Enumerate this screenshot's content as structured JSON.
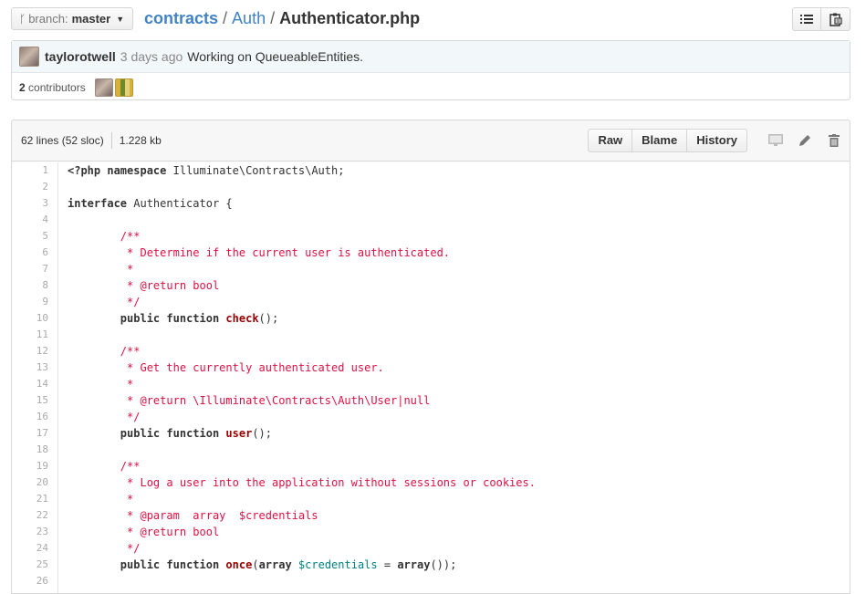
{
  "branch": {
    "label": "branch:",
    "name": "master"
  },
  "breadcrumb": {
    "root": "contracts",
    "dir": "Auth",
    "file": "Authenticator.php",
    "sep": "/"
  },
  "commit": {
    "author": "taylorotwell",
    "time": "3 days ago",
    "message": "Working on QueueableEntities.",
    "contributors_count": "2",
    "contributors_label": "contributors"
  },
  "file": {
    "lines_info": "62 lines (52 sloc)",
    "size": "1.228 kb",
    "buttons": {
      "raw": "Raw",
      "blame": "Blame",
      "history": "History"
    }
  },
  "code_lines": [
    [
      {
        "t": "<?php ",
        "c": "kw"
      },
      {
        "t": "namespace",
        "c": "kw"
      },
      {
        "t": " Illuminate\\Contracts\\Auth;",
        "c": ""
      }
    ],
    [],
    [
      {
        "t": "interface",
        "c": "kw"
      },
      {
        "t": " Authenticator {",
        "c": ""
      }
    ],
    [],
    [
      {
        "t": "        /**",
        "c": "cm"
      }
    ],
    [
      {
        "t": "         * Determine if the current user is authenticated.",
        "c": "cm"
      }
    ],
    [
      {
        "t": "         *",
        "c": "cm"
      }
    ],
    [
      {
        "t": "         * @return bool",
        "c": "cm"
      }
    ],
    [
      {
        "t": "         */",
        "c": "cm"
      }
    ],
    [
      {
        "t": "        ",
        "c": ""
      },
      {
        "t": "public",
        "c": "kw"
      },
      {
        "t": " ",
        "c": ""
      },
      {
        "t": "function",
        "c": "kw"
      },
      {
        "t": " ",
        "c": ""
      },
      {
        "t": "check",
        "c": "fn"
      },
      {
        "t": "();",
        "c": ""
      }
    ],
    [],
    [
      {
        "t": "        /**",
        "c": "cm"
      }
    ],
    [
      {
        "t": "         * Get the currently authenticated user.",
        "c": "cm"
      }
    ],
    [
      {
        "t": "         *",
        "c": "cm"
      }
    ],
    [
      {
        "t": "         * @return \\Illuminate\\Contracts\\Auth\\User|null",
        "c": "cm"
      }
    ],
    [
      {
        "t": "         */",
        "c": "cm"
      }
    ],
    [
      {
        "t": "        ",
        "c": ""
      },
      {
        "t": "public",
        "c": "kw"
      },
      {
        "t": " ",
        "c": ""
      },
      {
        "t": "function",
        "c": "kw"
      },
      {
        "t": " ",
        "c": ""
      },
      {
        "t": "user",
        "c": "fn"
      },
      {
        "t": "();",
        "c": ""
      }
    ],
    [],
    [
      {
        "t": "        /**",
        "c": "cm"
      }
    ],
    [
      {
        "t": "         * Log a user into the application without sessions or cookies.",
        "c": "cm"
      }
    ],
    [
      {
        "t": "         *",
        "c": "cm"
      }
    ],
    [
      {
        "t": "         * @param  array  $credentials",
        "c": "cm"
      }
    ],
    [
      {
        "t": "         * @return bool",
        "c": "cm"
      }
    ],
    [
      {
        "t": "         */",
        "c": "cm"
      }
    ],
    [
      {
        "t": "        ",
        "c": ""
      },
      {
        "t": "public",
        "c": "kw"
      },
      {
        "t": " ",
        "c": ""
      },
      {
        "t": "function",
        "c": "kw"
      },
      {
        "t": " ",
        "c": ""
      },
      {
        "t": "once",
        "c": "fn"
      },
      {
        "t": "(",
        "c": ""
      },
      {
        "t": "array",
        "c": "kw"
      },
      {
        "t": " ",
        "c": ""
      },
      {
        "t": "$credentials",
        "c": "var"
      },
      {
        "t": " = ",
        "c": ""
      },
      {
        "t": "array",
        "c": "kw"
      },
      {
        "t": "());",
        "c": ""
      }
    ],
    []
  ],
  "icons": {
    "branch": "branch-icon",
    "list": "list-icon",
    "clipboard": "clipboard-icon",
    "desktop": "desktop-icon",
    "edit": "pencil-icon",
    "delete": "trash-icon"
  }
}
